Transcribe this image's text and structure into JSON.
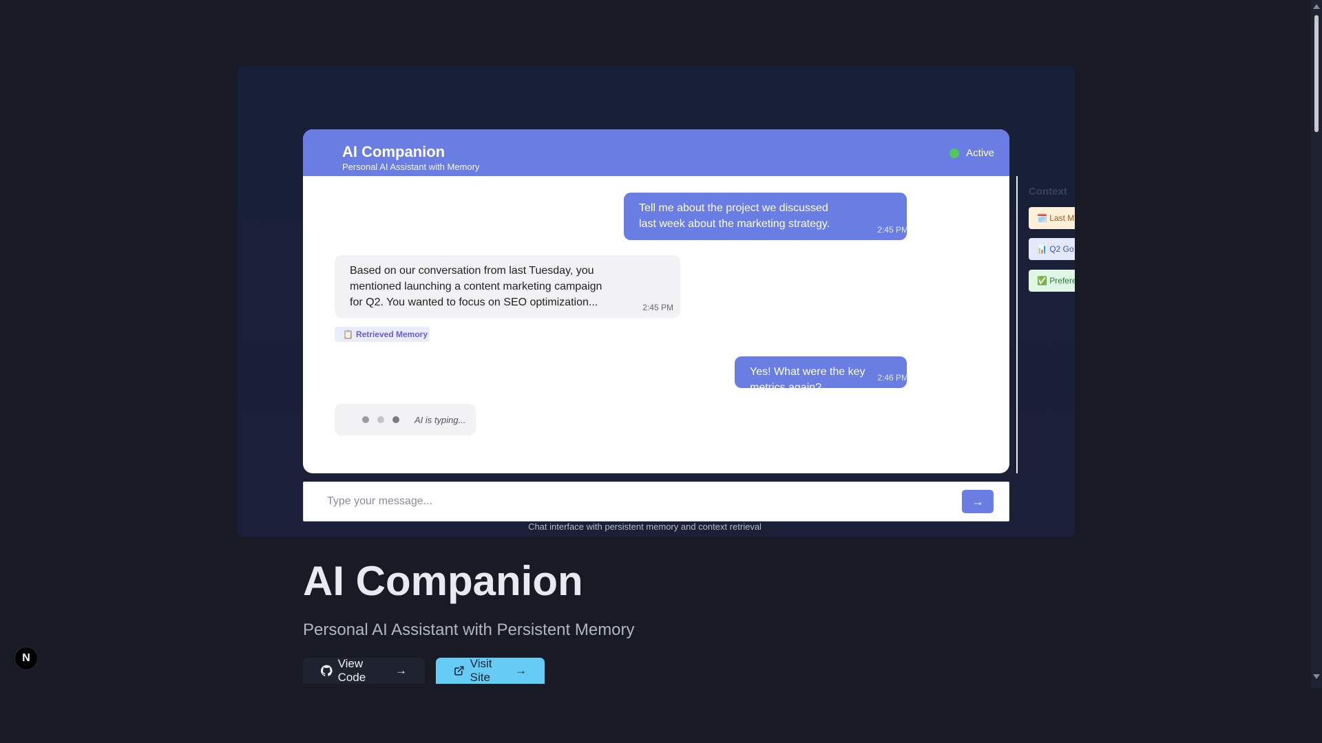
{
  "chat": {
    "title": "AI Companion",
    "subtitle": "Personal AI Assistant with Memory",
    "status": "Active",
    "messages": [
      {
        "text": "Tell me about the project we discussed\nlast week about the marketing strategy.",
        "time": "2:45 PM"
      },
      {
        "text": "Based on our conversation from last Tuesday, you\nmentioned launching a content marketing campaign\nfor Q2. You wanted to focus on SEO optimization...",
        "time": "2:45 PM"
      },
      {
        "text": "Yes! What were the key metrics again?",
        "time": "2:46 PM"
      }
    ],
    "memory_badge": "Retrieved Memory",
    "memory_icon": "clipboard-icon",
    "typing_label": "AI is typing...",
    "input_placeholder": "Type your message...",
    "send_label": "→",
    "caption": "Chat interface with persistent memory and context retrieval"
  },
  "context": {
    "title": "Context",
    "items": [
      {
        "label": "🗓️ Last M",
        "icon": "calendar-icon"
      },
      {
        "label": "📊 Q2 Go",
        "icon": "bar-chart-icon"
      },
      {
        "label": "✅ Prefere",
        "icon": "check-icon"
      }
    ]
  },
  "page": {
    "title": "AI Companion",
    "subtitle": "Personal AI Assistant with Persistent Memory",
    "view_code": "View Code",
    "visit_site": "Visit Site",
    "arrow": "→",
    "next_badge": "N"
  },
  "colors": {
    "accent": "#6a7de3",
    "status": "#4fc95a",
    "visit_button": "#66ccf5",
    "background": "#181b26"
  }
}
